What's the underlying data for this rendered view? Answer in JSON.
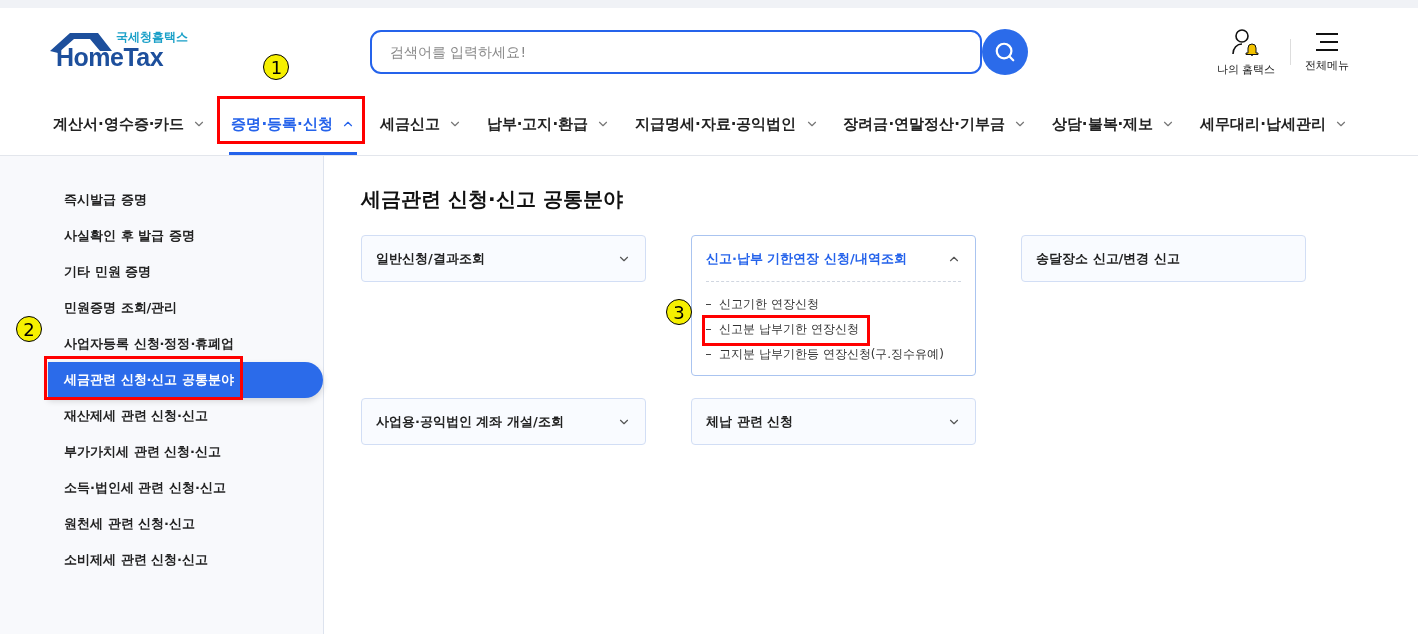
{
  "logo": {
    "subtitle": "국세청홈택스",
    "title": "HomeTax"
  },
  "search": {
    "placeholder": "검색어를 입력하세요!"
  },
  "utilities": [
    {
      "kind": "account",
      "label": "나의 홈택스"
    },
    {
      "kind": "menu",
      "label": "전체메뉴"
    }
  ],
  "nav": [
    {
      "label": "계산서·영수증·카드",
      "selected": false,
      "highlighted": false
    },
    {
      "label": "증명·등록·신청",
      "selected": true,
      "highlighted": true,
      "marker": "1"
    },
    {
      "label": "세금신고",
      "selected": false,
      "highlighted": false
    },
    {
      "label": "납부·고지·환급",
      "selected": false,
      "highlighted": false
    },
    {
      "label": "지급명세·자료·공익법인",
      "selected": false,
      "highlighted": false
    },
    {
      "label": "장려금·연말정산·기부금",
      "selected": false,
      "highlighted": false
    },
    {
      "label": "상담·불복·제보",
      "selected": false,
      "highlighted": false
    },
    {
      "label": "세무대리·납세관리",
      "selected": false,
      "highlighted": false
    }
  ],
  "sidebar": {
    "items": [
      {
        "label": "즉시발급 증명",
        "selected": false,
        "highlighted": false
      },
      {
        "label": "사실확인 후 발급 증명",
        "selected": false,
        "highlighted": false
      },
      {
        "label": "기타 민원 증명",
        "selected": false,
        "highlighted": false
      },
      {
        "label": "민원증명 조회/관리",
        "selected": false,
        "highlighted": false
      },
      {
        "label": "사업자등록 신청·정정·휴폐업",
        "selected": false,
        "highlighted": false,
        "marker": "2"
      },
      {
        "label": "세금관련 신청·신고 공통분야",
        "selected": true,
        "highlighted": true
      },
      {
        "label": "재산제세 관련 신청·신고",
        "selected": false,
        "highlighted": false
      },
      {
        "label": "부가가치세 관련 신청·신고",
        "selected": false,
        "highlighted": false
      },
      {
        "label": "소득·법인세 관련 신청·신고",
        "selected": false,
        "highlighted": false
      },
      {
        "label": "원천세 관련 신청·신고",
        "selected": false,
        "highlighted": false
      },
      {
        "label": "소비제세 관련 신청·신고",
        "selected": false,
        "highlighted": false
      }
    ]
  },
  "content": {
    "title": "세금관련 신청·신고 공통분야",
    "cards": [
      {
        "title": "일반신청/결과조회",
        "expanded": false
      },
      {
        "title": "신고·납부 기한연장 신청/내역조회",
        "expanded": true,
        "items": [
          {
            "label": "신고기한 연장신청",
            "highlighted": false
          },
          {
            "label": "신고분 납부기한 연장신청",
            "highlighted": true,
            "marker": "3"
          },
          {
            "label": "고지분 납부기한등 연장신청(구.징수유예)",
            "highlighted": false
          }
        ]
      },
      {
        "title": "송달장소 신고/변경 신고",
        "expanded": false,
        "arrow": false
      },
      {
        "title": "사업용·공익법인 계좌 개설/조회",
        "expanded": false
      },
      {
        "title": "체납 관련 신청",
        "expanded": false
      }
    ]
  }
}
